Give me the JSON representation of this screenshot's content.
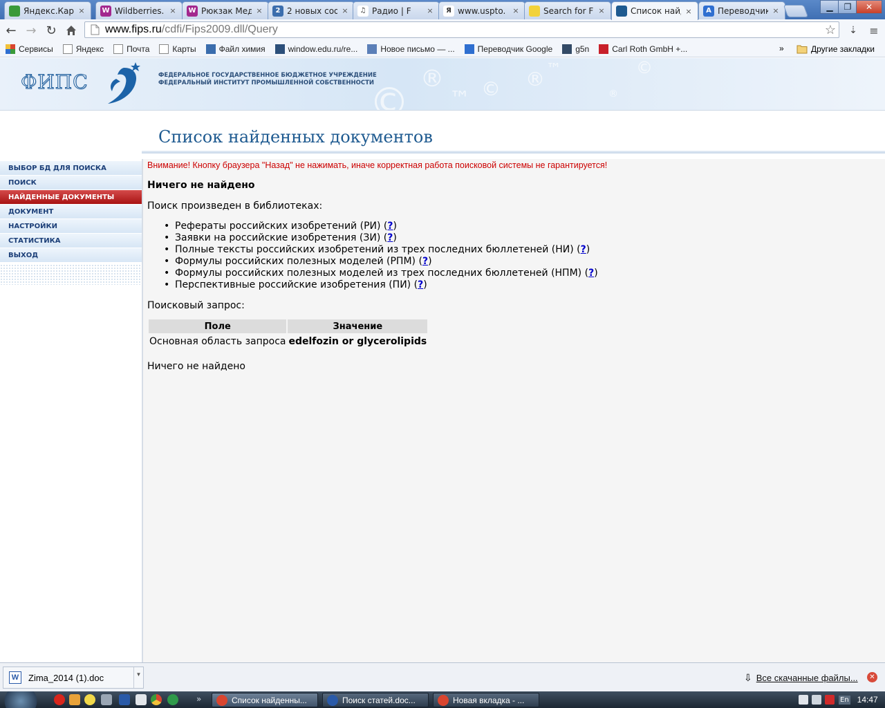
{
  "browser": {
    "tabs": [
      {
        "title": "Яндекс.Карт",
        "favicon_color": "#3a9a3a",
        "favicon_text": ""
      },
      {
        "title": "Wildberries.",
        "favicon_color": "#a3288e",
        "favicon_text": "W"
      },
      {
        "title": "Рюкзак Мед",
        "favicon_color": "#a3288e",
        "favicon_text": "W"
      },
      {
        "title": "2 новых соо",
        "favicon_color": "#3b6dad",
        "favicon_text": "2"
      },
      {
        "title": "Радио | F",
        "favicon_color": "#ffffff",
        "favicon_text": "♫"
      },
      {
        "title": "www.uspto.",
        "favicon_color": "#ffffff",
        "favicon_text": "Я"
      },
      {
        "title": "Search for F",
        "favicon_color": "#f2d23a",
        "favicon_text": ""
      },
      {
        "title": "Список найд",
        "favicon_color": "#1e5a90",
        "favicon_text": ""
      },
      {
        "title": "Переводчик",
        "favicon_color": "#2f6fd0",
        "favicon_text": "A"
      }
    ],
    "active_tab_index": 7,
    "address": {
      "host": "www.fips.ru",
      "path": "/cdfi/Fips2009.dll/Query"
    },
    "bookmarks": [
      {
        "label": "Сервисы",
        "icon": "apps-grid-icon"
      },
      {
        "label": "Яндекс",
        "icon": "page-icon"
      },
      {
        "label": "Почта",
        "icon": "page-icon"
      },
      {
        "label": "Карты",
        "icon": "page-icon"
      },
      {
        "label": "Файл химия",
        "icon": "help-site-icon"
      },
      {
        "label": "window.edu.ru/re...",
        "icon": "book-icon"
      },
      {
        "label": "Новое письмо — ...",
        "icon": "mail-icon"
      },
      {
        "label": "Переводчик Google",
        "icon": "translate-icon"
      },
      {
        "label": "g5n",
        "icon": "play-icon"
      },
      {
        "label": "Carl Roth GmbH +...",
        "icon": "roth-icon"
      }
    ],
    "bookmarks_more": "»",
    "other_bookmarks": "Другие закладки"
  },
  "site": {
    "logo_text": "ФИПС",
    "org_line1": "ФЕДЕРАЛЬНОЕ ГОСУДАРСТВЕННОЕ БЮДЖЕТНОЕ УЧРЕЖДЕНИЕ",
    "org_line2": "ФЕДЕРАЛЬНЫЙ ИНСТИТУТ ПРОМЫШЛЕННОЙ СОБСТВЕННОСТИ",
    "page_title": "Список найденных документов",
    "menu": [
      {
        "label": "ВЫБОР БД ДЛЯ ПОИСКА",
        "active": false
      },
      {
        "label": "ПОИСК",
        "active": false
      },
      {
        "label": "НАЙДЕННЫЕ ДОКУМЕНТЫ",
        "active": true
      },
      {
        "label": "ДОКУМЕНТ",
        "active": false
      },
      {
        "label": "НАСТРОЙКИ",
        "active": false
      },
      {
        "label": "СТАТИСТИКА",
        "active": false
      },
      {
        "label": "ВЫХОД",
        "active": false
      }
    ],
    "warning": "Внимание! Кнопку браузера \"Назад\" не нажимать, иначе корректная работа поисковой системы не гарантируется!",
    "nothing_found_bold": "Ничего не найдено",
    "libraries_intro": "Поиск произведен в библиотеках:",
    "libraries": [
      "Рефераты российских изобретений (РИ)",
      "Заявки на российские изобретения (ЗИ)",
      "Полные тексты российских изобретений из трех последних бюллетеней (НИ)",
      "Формулы российских полезных моделей (РПМ)",
      "Формулы российских полезных моделей из трех последних бюллетеней (НПМ)",
      "Перспективные российские изобретения (ПИ)"
    ],
    "help_link": "?",
    "query_intro": "Поисковый запрос:",
    "query_table": {
      "headers": [
        "Поле",
        "Значение"
      ],
      "rows": [
        [
          "Основная область запроса",
          "edelfozin or glycerolipids"
        ]
      ]
    },
    "nothing_found_plain": "Ничего не найдено"
  },
  "downloads": {
    "item": "Zima_2014 (1).doc",
    "all_downloads": "Все скачанные файлы..."
  },
  "taskbar": {
    "tasks": [
      {
        "label": "Список найденны...",
        "active": true,
        "icon_color": "#d9452f"
      },
      {
        "label": "Поиск статей.doc...",
        "active": false,
        "icon_color": "#2a5aa8"
      },
      {
        "label": "Новая вкладка - ...",
        "active": false,
        "icon_color": "#d9452f"
      }
    ],
    "lang": "En",
    "clock": "14:47"
  }
}
